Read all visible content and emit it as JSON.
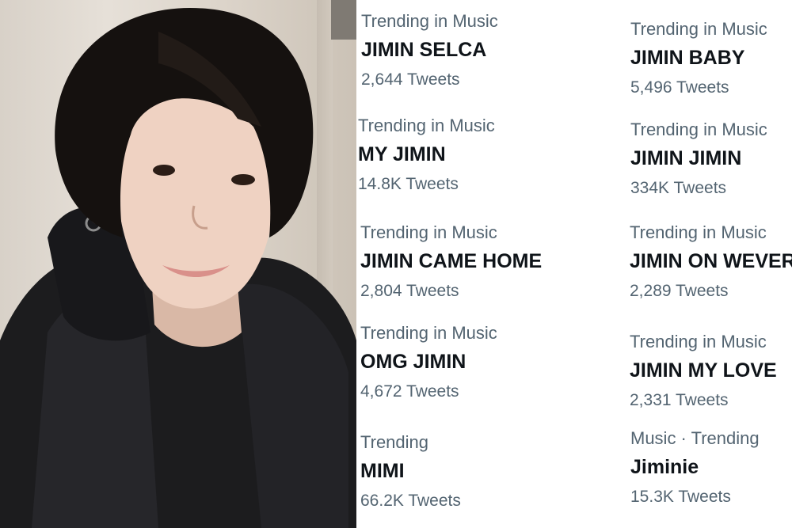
{
  "trends_left": [
    {
      "context": "Trending in Music",
      "name": "JIMIN SELCA",
      "count": "2,644 Tweets"
    },
    {
      "context": "Trending in Music",
      "name": "MY JIMIN",
      "count": "14.8K Tweets"
    },
    {
      "context": "Trending in Music",
      "name": "JIMIN CAME HOME",
      "count": "2,804 Tweets"
    },
    {
      "context": "Trending in Music",
      "name": "OMG JIMIN",
      "count": "4,672 Tweets"
    },
    {
      "context": "Trending",
      "name": "MIMI",
      "count": "66.2K Tweets"
    }
  ],
  "trends_right": [
    {
      "context": "Trending in Music",
      "name": "JIMIN BABY",
      "count": "5,496 Tweets"
    },
    {
      "context": "Trending in Music",
      "name": "JIMIN JIMIN",
      "count": "334K Tweets"
    },
    {
      "context": "Trending in Music",
      "name": "JIMIN ON WEVERSE",
      "count": "2,289 Tweets"
    },
    {
      "context": "Trending in Music",
      "name": "JIMIN MY LOVE",
      "count": "2,331 Tweets"
    },
    {
      "context": "Music · Trending",
      "name": "Jiminie",
      "count": "15.3K Tweets"
    }
  ],
  "colors": {
    "text_primary": "#0f1419",
    "text_secondary": "#536471",
    "background": "#ffffff"
  }
}
